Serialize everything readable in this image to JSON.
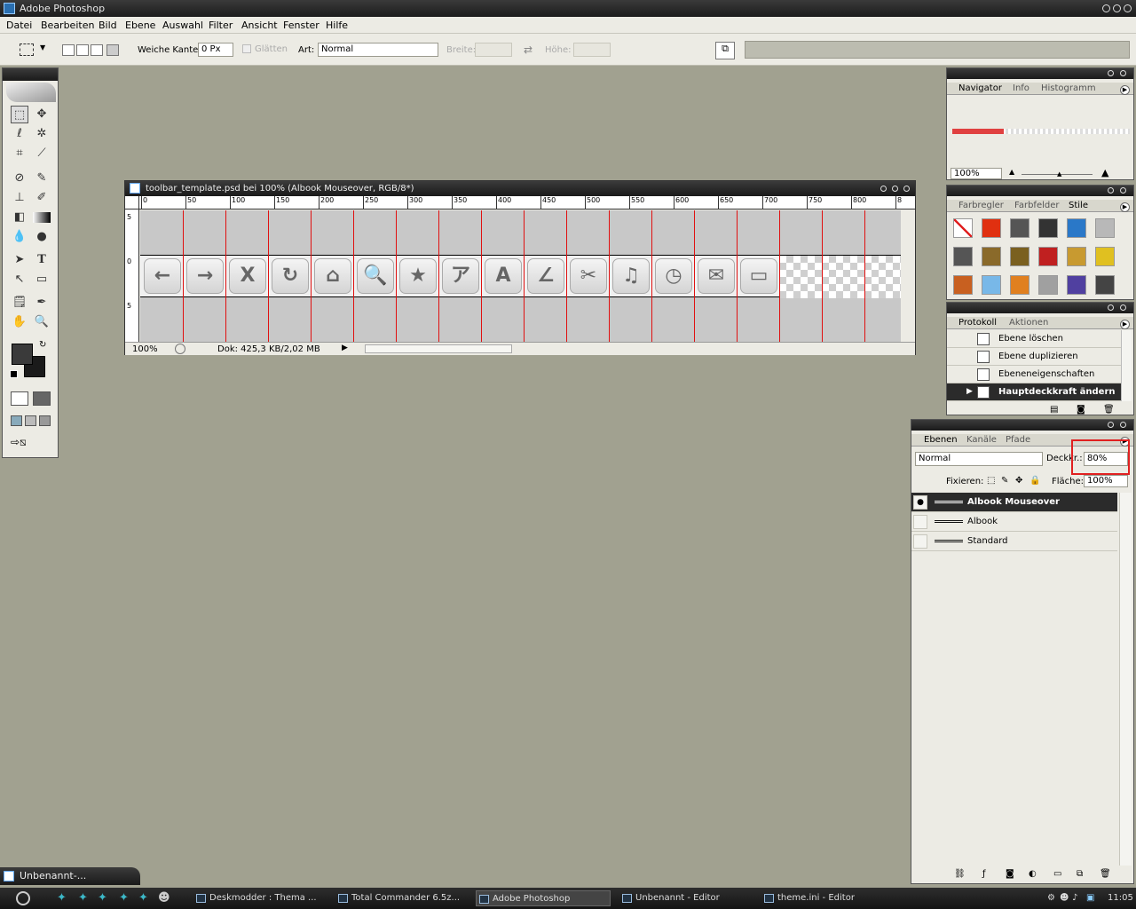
{
  "app": {
    "title": "Adobe Photoshop"
  },
  "menu": [
    "Datei",
    "Bearbeiten",
    "Bild",
    "Ebene",
    "Auswahl",
    "Filter",
    "Ansicht",
    "Fenster",
    "Hilfe"
  ],
  "options": {
    "feather_label": "Weiche Kante:",
    "feather_value": "0 Px",
    "antialias_label": "Glätten",
    "style_label": "Art:",
    "style_value": "Normal",
    "width_label": "Breite:",
    "height_label": "Höhe:"
  },
  "document": {
    "title": "toolbar_template.psd bei 100% (Albook Mouseover, RGB/8*)",
    "zoom": "100%",
    "doc_info": "Dok: 425,3 KB/2,02 MB",
    "ruler_ticks": [
      "0",
      "50",
      "100",
      "150",
      "200",
      "250",
      "300",
      "350",
      "400",
      "450",
      "500",
      "550",
      "600",
      "650",
      "700",
      "750",
      "800",
      "8"
    ],
    "left_ruler_ticks": [
      "5",
      "0",
      "5"
    ],
    "toolbar_icons": [
      "←",
      "→",
      "X",
      "↻",
      "⌂",
      "🔍",
      "★",
      "ア",
      "A",
      "∠",
      "✂",
      "♫",
      "◷",
      "✉",
      "▭"
    ]
  },
  "navigator": {
    "tabs": [
      "Navigator",
      "Info",
      "Histogramm"
    ],
    "zoom": "100%"
  },
  "styles": {
    "tabs": [
      "Farbregler",
      "Farbfelder",
      "Stile"
    ],
    "swatches": [
      "#ffffff",
      "#e03010",
      "#555555",
      "#333333",
      "#2a78c8",
      "#b8b8b8",
      "#555555",
      "#8a6a2a",
      "#7a6020",
      "#c02020",
      "#c89a30",
      "#e0c020",
      "#c86020",
      "#78b8e8",
      "#e08020",
      "#a0a0a0",
      "#5040a0",
      "#444444"
    ]
  },
  "history": {
    "tabs": [
      "Protokoll",
      "Aktionen"
    ],
    "items": [
      "Ebene löschen",
      "Ebene duplizieren",
      "Ebeneneigenschaften",
      "Hauptdeckkraft ändern"
    ]
  },
  "layers": {
    "tabs": [
      "Ebenen",
      "Kanäle",
      "Pfade"
    ],
    "blend_mode": "Normal",
    "opacity_label": "Deckkr.:",
    "opacity_value": "80%",
    "lock_label": "Fixieren:",
    "fill_label": "Fläche:",
    "fill_value": "100%",
    "items": [
      "Albook Mouseover",
      "Albook",
      "Standard"
    ]
  },
  "minimized_doc": "Unbenannt-...",
  "taskbar": {
    "tasks": [
      "Deskmodder : Thema ...",
      "Total Commander 6.5z...",
      "Adobe Photoshop",
      "Unbenannt - Editor",
      "theme.ini - Editor"
    ],
    "clock": "11:05"
  }
}
